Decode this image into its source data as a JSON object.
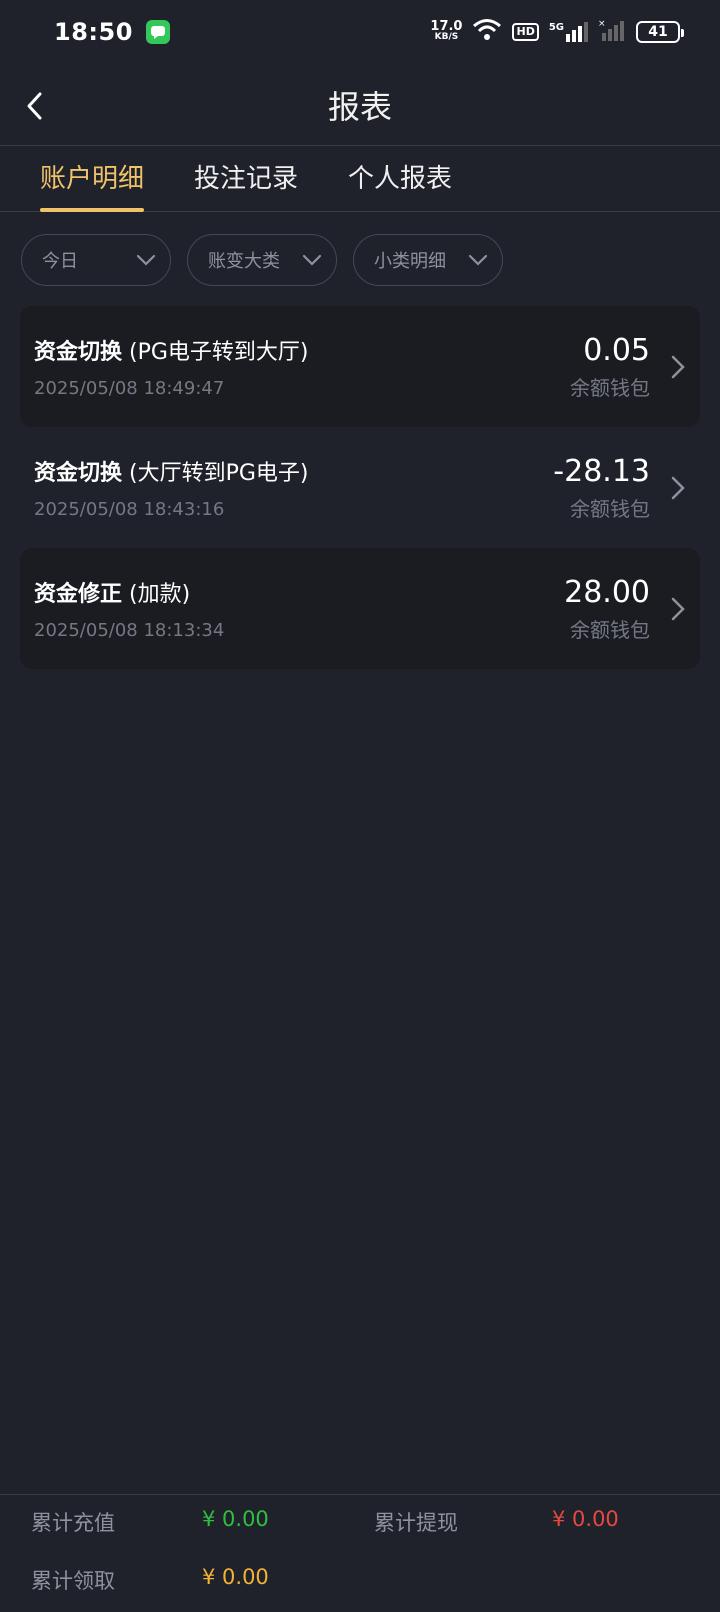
{
  "status": {
    "time": "18:50",
    "net_speed_value": "17.0",
    "net_speed_unit": "KB/S",
    "hd": "HD",
    "network": "5G",
    "battery": "41"
  },
  "header": {
    "title": "报表"
  },
  "tabs": [
    {
      "label": "账户明细",
      "active": true
    },
    {
      "label": "投注记录",
      "active": false
    },
    {
      "label": "个人报表",
      "active": false
    }
  ],
  "filters": [
    {
      "label": "今日"
    },
    {
      "label": "账变大类"
    },
    {
      "label": "小类明细"
    }
  ],
  "records": [
    {
      "title_bold": "资金切换",
      "title_rest": "(PG电子转到大厅)",
      "time": "2025/05/08 18:49:47",
      "amount": "0.05",
      "wallet": "余额钱包"
    },
    {
      "title_bold": "资金切换",
      "title_rest": "(大厅转到PG电子)",
      "time": "2025/05/08 18:43:16",
      "amount": "-28.13",
      "wallet": "余额钱包"
    },
    {
      "title_bold": "资金修正",
      "title_rest": "(加款)",
      "time": "2025/05/08 18:13:34",
      "amount": "28.00",
      "wallet": "余额钱包"
    }
  ],
  "summary": {
    "recharge_label": "累计充值",
    "recharge_value": "¥ 0.00",
    "withdraw_label": "累计提现",
    "withdraw_value": "¥ 0.00",
    "claim_label": "累计领取",
    "claim_value": "¥ 0.00"
  },
  "colors": {
    "accent": "#f0c26a",
    "recharge": "#2fbf3f",
    "withdraw": "#e5483f",
    "claim": "#f2b233"
  }
}
